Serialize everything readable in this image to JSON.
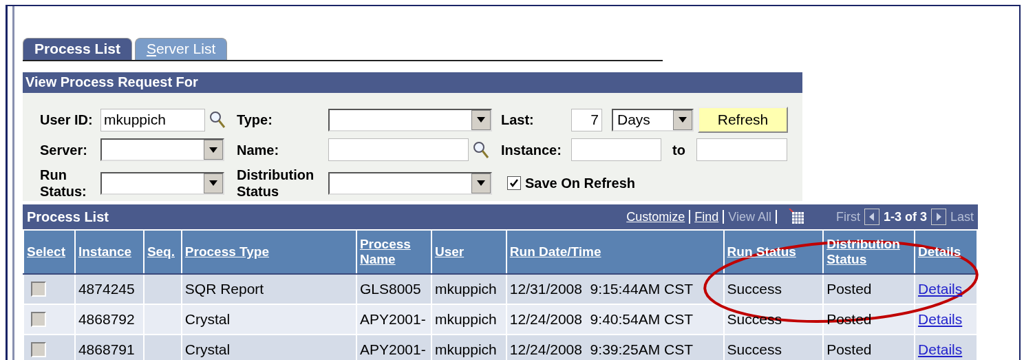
{
  "tabs": [
    {
      "label": "Process List",
      "selected": true,
      "accesskey": false
    },
    {
      "label": "Server List",
      "selected": false,
      "accesskey": true
    }
  ],
  "request_panel": {
    "title": "View Process Request For",
    "user_id": {
      "label": "User ID:",
      "value": "mkuppich"
    },
    "type": {
      "label": "Type:"
    },
    "last": {
      "label": "Last:",
      "value": "7",
      "unit": "Days"
    },
    "refresh_button": "Refresh",
    "server": {
      "label": "Server:"
    },
    "name": {
      "label": "Name:"
    },
    "instance": {
      "label": "Instance:",
      "to_label": "to"
    },
    "run_status": {
      "label": "Run Status:"
    },
    "distribution_status": {
      "label": "Distribution Status"
    },
    "save_on_refresh": {
      "label": "Save On Refresh",
      "checked": true
    }
  },
  "process_list": {
    "title": "Process List",
    "links": [
      {
        "label": "Customize",
        "disabled": false
      },
      {
        "label": "Find",
        "disabled": false
      },
      {
        "label": "View All",
        "disabled": true
      }
    ],
    "first": {
      "label": "First",
      "disabled": true
    },
    "range": "1-3 of 3",
    "last": {
      "label": "Last",
      "disabled": true
    },
    "columns": [
      "Select",
      "Instance",
      "Seq.",
      "Process Type",
      "Process Name",
      "User",
      "Run Date/Time",
      "Run Status",
      "Distribution Status",
      "Details"
    ],
    "rows": [
      {
        "checked": false,
        "instance": "4874245",
        "process_type": "SQR Report",
        "process_name": "GLS8005",
        "user": "mkuppich",
        "run_date_time": "12/31/2008  9:15:44AM CST",
        "run_status": "Success",
        "distribution_status": "Posted",
        "details": "Details"
      },
      {
        "checked": false,
        "instance": "4868792",
        "process_type": "Crystal",
        "process_name": "APY2001-",
        "user": "mkuppich",
        "run_date_time": "12/24/2008  9:40:54AM CST",
        "run_status": "Success",
        "distribution_status": "Posted",
        "details": "Details"
      },
      {
        "checked": false,
        "instance": "4868791",
        "process_type": "Crystal",
        "process_name": "APY2001-",
        "user": "mkuppich",
        "run_date_time": "12/24/2008  9:39:25AM CST",
        "run_status": "Success",
        "distribution_status": "Posted",
        "details": "Details"
      }
    ]
  },
  "annotation": {
    "kind": "ellipse",
    "color": "#c00000"
  }
}
